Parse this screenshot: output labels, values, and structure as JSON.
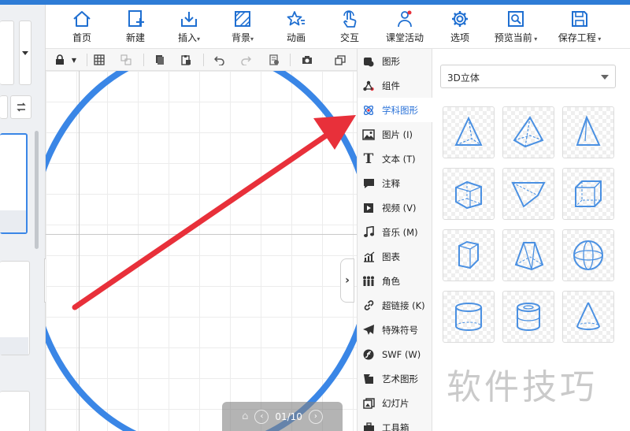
{
  "toolbar": {
    "items": [
      {
        "label": "首页",
        "icon": "home-icon",
        "dropdown": false
      },
      {
        "label": "新建",
        "icon": "new-page-icon",
        "dropdown": false
      },
      {
        "label": "插入",
        "icon": "insert-icon",
        "dropdown": true
      },
      {
        "label": "背景",
        "icon": "background-icon",
        "dropdown": true
      },
      {
        "label": "动画",
        "icon": "animation-icon",
        "dropdown": false
      },
      {
        "label": "交互",
        "icon": "interaction-icon",
        "dropdown": false
      },
      {
        "label": "课堂活动",
        "icon": "classroom-activity-icon",
        "dropdown": false
      },
      {
        "label": "选项",
        "icon": "gear-icon",
        "dropdown": false
      },
      {
        "label": "预览当前",
        "icon": "preview-icon",
        "dropdown": true
      },
      {
        "label": "保存工程",
        "icon": "save-icon",
        "dropdown": true
      }
    ]
  },
  "categories": [
    {
      "label": "图形",
      "icon": "shape-icon",
      "active": false
    },
    {
      "label": "组件",
      "icon": "component-icon",
      "active": false
    },
    {
      "label": "学科图形",
      "icon": "atom-icon",
      "active": true
    },
    {
      "label": "图片 (I)",
      "icon": "image-icon",
      "active": false
    },
    {
      "label": "文本 (T)",
      "icon": "text-icon",
      "active": false
    },
    {
      "label": "注释",
      "icon": "comment-icon",
      "active": false
    },
    {
      "label": "视频 (V)",
      "icon": "video-icon",
      "active": false
    },
    {
      "label": "音乐 (M)",
      "icon": "music-icon",
      "active": false
    },
    {
      "label": "图表",
      "icon": "chart-icon",
      "active": false
    },
    {
      "label": "角色",
      "icon": "people-icon",
      "active": false
    },
    {
      "label": "超链接 (K)",
      "icon": "link-icon",
      "active": false
    },
    {
      "label": "特殊符号",
      "icon": "airplane-icon",
      "active": false
    },
    {
      "label": "SWF (W)",
      "icon": "flash-icon",
      "active": false
    },
    {
      "label": "艺术图形",
      "icon": "art-shape-icon",
      "active": false
    },
    {
      "label": "幻灯片",
      "icon": "slide-icon",
      "active": false
    },
    {
      "label": "工具箱",
      "icon": "toolbox-icon",
      "active": false
    }
  ],
  "shape_panel": {
    "dropdown_value": "3D立体",
    "shapes": [
      "tetrahedron",
      "square-pyramid",
      "triangular-pyramid",
      "cube-slanted",
      "triangular-prism",
      "cube",
      "hexagonal-prism",
      "frustum",
      "sphere",
      "cylinder",
      "hollow-cylinder",
      "cone"
    ]
  },
  "pager": {
    "text": "01/10"
  },
  "watermark": "软件技巧",
  "colors": {
    "accent": "#2a72d8",
    "shape_stroke": "#4a90e2",
    "arrow": "#e8303a",
    "topbar": "#2e7cd6"
  }
}
